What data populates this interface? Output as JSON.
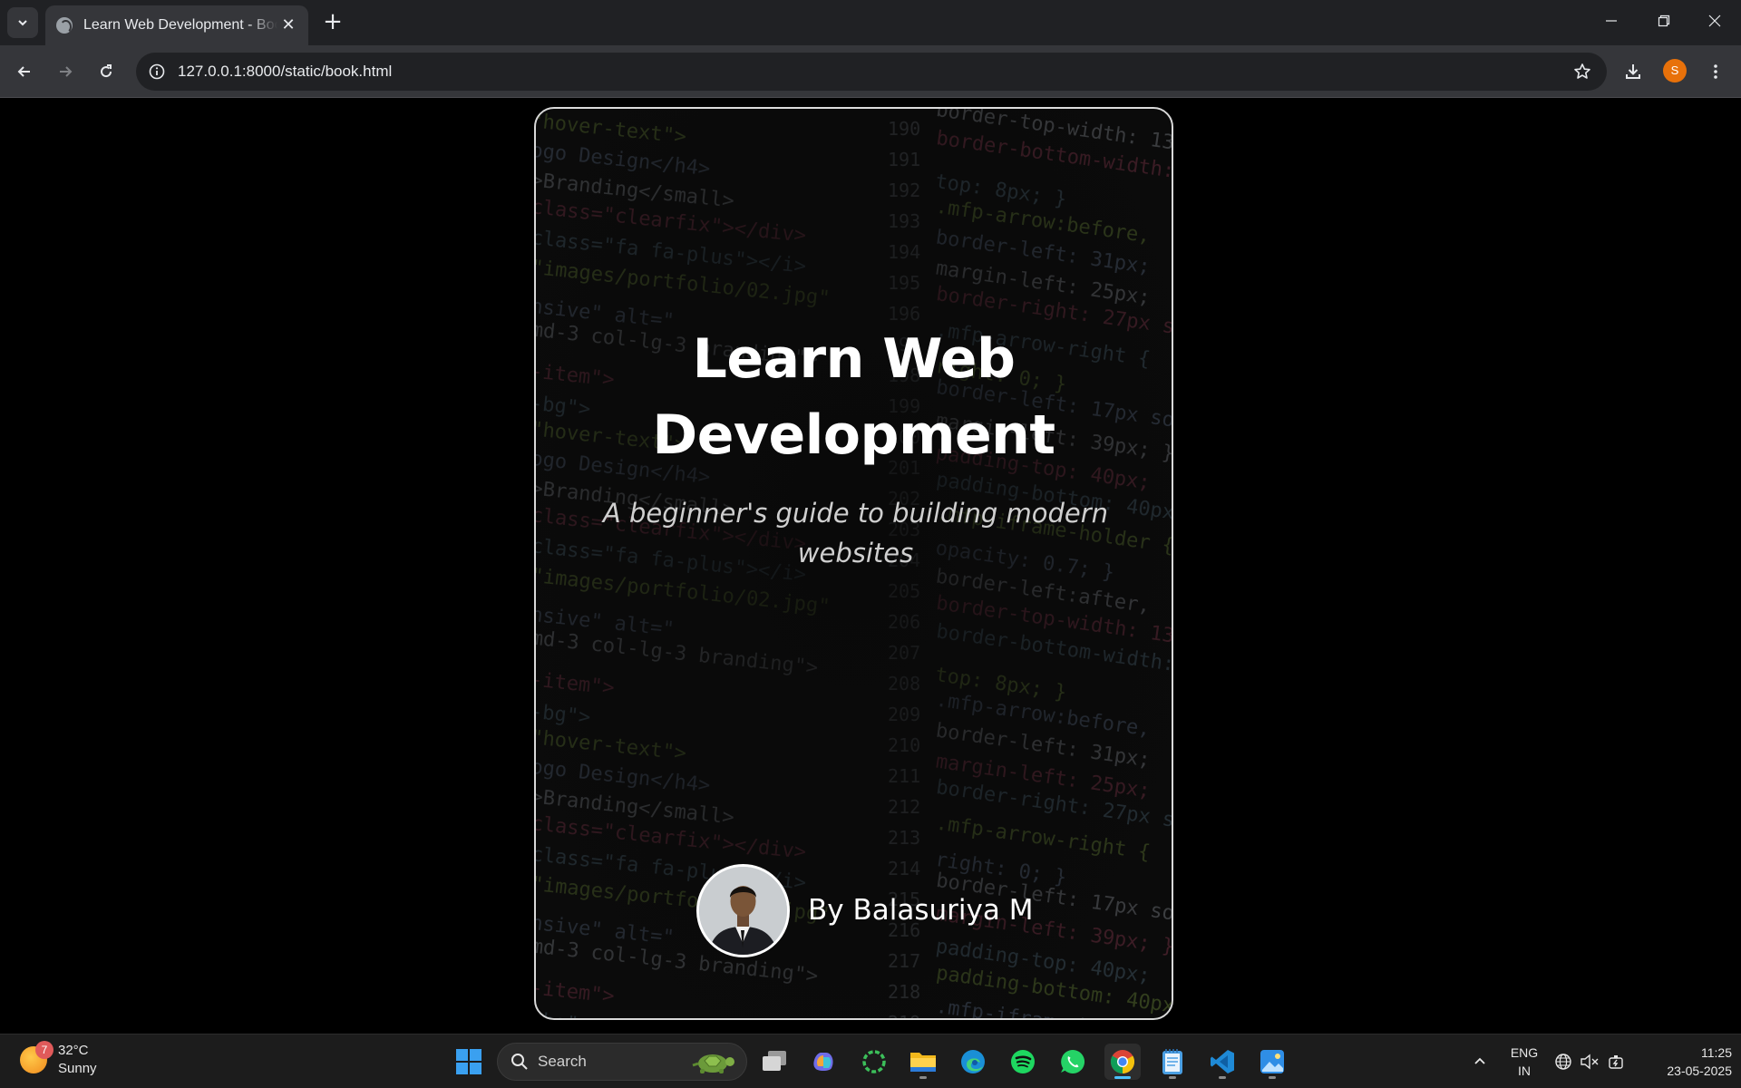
{
  "browser": {
    "tab_title": "Learn Web Development - Book",
    "tab_close_glyph": "✕",
    "new_tab_glyph": "+",
    "url": "127.0.0.1:8000/static/book.html",
    "profile_initial": "S",
    "icons": [
      "tab-list-icon",
      "globe-favicon-icon",
      "minimize-icon",
      "restore-icon",
      "close-window-icon",
      "back-icon",
      "forward-icon",
      "reload-icon",
      "site-info-icon",
      "bookmark-star-icon",
      "download-icon",
      "menu-kebab-icon"
    ]
  },
  "book": {
    "title_line1": "Learn Web",
    "title_line2": "Development",
    "subtitle_line1": "A beginner's guide to building modern",
    "subtitle_line2": "websites",
    "author": "By Balasuriya M"
  },
  "taskbar": {
    "weather": {
      "temp": "32°C",
      "condition": "Sunny",
      "badge": "7"
    },
    "search_label": "Search",
    "lang_line1": "ENG",
    "lang_line2": "IN",
    "time": "11:25",
    "date": "23-05-2025",
    "apps": [
      "windows-start-icon",
      "search-icon",
      "task-view-icon",
      "copilot-icon",
      "circle-app-icon",
      "file-explorer-icon",
      "edge-icon",
      "spotify-icon",
      "whatsapp-icon",
      "chrome-icon",
      "notepad-icon",
      "vscode-icon",
      "photos-icon"
    ]
  },
  "colors": {
    "chrome_dark": "#202124",
    "chrome_toolbar": "#35363a",
    "page_bg": "#000000",
    "cover_border": "#d9d9d9",
    "title": "#ffffff",
    "profile": "#e8710a",
    "taskbar": "#1c1c1c",
    "accent": "#4cc2ff"
  }
}
